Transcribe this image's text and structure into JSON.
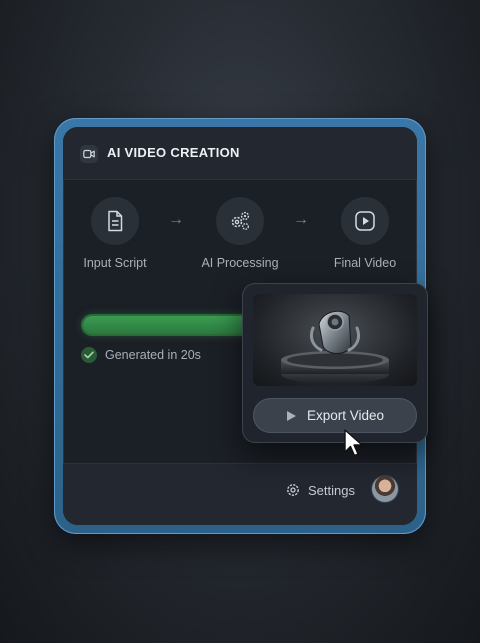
{
  "header": {
    "icon": "video-camera-icon",
    "title": "AI VIDEO CREATION"
  },
  "steps": [
    {
      "label": "Input Script",
      "icon": "document-icon"
    },
    {
      "label": "AI Processing",
      "icon": "gears-icon"
    },
    {
      "label": "Final Video",
      "icon": "play-icon"
    }
  ],
  "progress": {
    "fraction": 1.0,
    "color": "#2f8a46"
  },
  "status": {
    "text": "Generated in 20s",
    "icon": "check-circle-icon"
  },
  "popup": {
    "action_label": "Export Video",
    "action_icon": "play-triangle-icon"
  },
  "footer": {
    "settings_label": "Settings",
    "settings_icon": "gear-icon"
  },
  "colors": {
    "frame_accent": "#3a77a8",
    "panel": "#1b1f26",
    "success": "#2b7a3e"
  }
}
